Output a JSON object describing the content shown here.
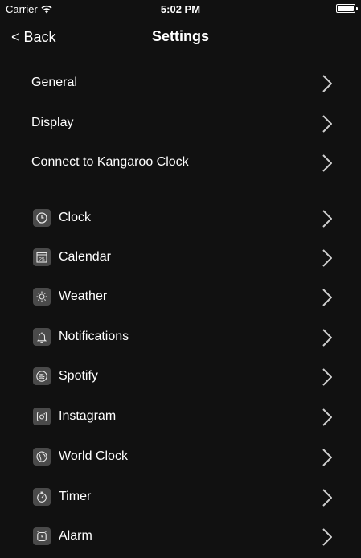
{
  "status_bar": {
    "carrier": "Carrier",
    "time": "5:02 PM",
    "battery_level": 1.0
  },
  "nav": {
    "back_label": "< Back",
    "title": "Settings"
  },
  "general_items": [
    {
      "label": "General"
    },
    {
      "label": "Display"
    },
    {
      "label": "Connect to Kangaroo Clock"
    }
  ],
  "app_items": [
    {
      "label": "Clock",
      "icon": "clock-icon"
    },
    {
      "label": "Calendar",
      "icon": "calendar-icon",
      "icon_text": "25"
    },
    {
      "label": "Weather",
      "icon": "sun-icon"
    },
    {
      "label": "Notifications",
      "icon": "bell-icon"
    },
    {
      "label": "Spotify",
      "icon": "spotify-icon"
    },
    {
      "label": "Instagram",
      "icon": "instagram-icon"
    },
    {
      "label": "World Clock",
      "icon": "globe-icon"
    },
    {
      "label": "Timer",
      "icon": "stopwatch-icon"
    },
    {
      "label": "Alarm",
      "icon": "alarm-clock-icon"
    }
  ],
  "colors": {
    "background": "#111111",
    "text": "#ffffff",
    "icon_tile": "#4a4a4a",
    "chevron": "#cfcfcf"
  }
}
